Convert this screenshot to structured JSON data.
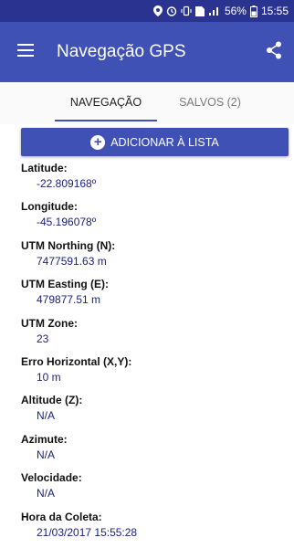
{
  "status_bar": {
    "icons": [
      "location-icon",
      "alarm-icon",
      "vibrate-icon",
      "sim-icon",
      "signal-icon"
    ],
    "battery": "56%",
    "time": "15:55"
  },
  "app_bar": {
    "title": "Navegação GPS",
    "menu_icon": "menu-icon",
    "share_icon": "share-icon"
  },
  "tabs": [
    {
      "label": "NAVEGAÇÃO",
      "active": true
    },
    {
      "label": "SALVOS (2)",
      "active": false
    }
  ],
  "add_button": {
    "label": "ADICIONAR À LISTA",
    "icon": "add-circle-icon"
  },
  "fields": [
    {
      "label": "Latitude:",
      "value": "-22.809168º"
    },
    {
      "label": "Longitude:",
      "value": "-45.196078º"
    },
    {
      "label": "UTM Northing (N):",
      "value": "7477591.63 m"
    },
    {
      "label": "UTM Easting (E):",
      "value": "479877.51 m"
    },
    {
      "label": "UTM Zone:",
      "value": "23"
    },
    {
      "label": "Erro Horizontal (X,Y):",
      "value": "10 m"
    },
    {
      "label": "Altitude (Z):",
      "value": "N/A"
    },
    {
      "label": "Azimute:",
      "value": "N/A"
    },
    {
      "label": "Velocidade:",
      "value": "N/A"
    },
    {
      "label": "Hora da Coleta:",
      "value": "21/03/2017 15:55:28"
    }
  ],
  "colors": {
    "primary": "#3f51b5",
    "status_bar": "#2b3391",
    "value_text": "#1a237e"
  }
}
